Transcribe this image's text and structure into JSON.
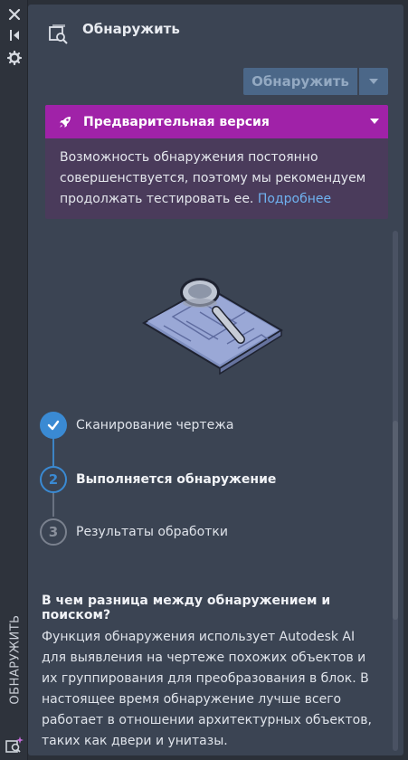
{
  "strip": {
    "icons": [
      "close-icon",
      "collapse-icon",
      "settings-icon",
      "detect-ai-icon"
    ],
    "label": "ОБНАРУЖИТЬ"
  },
  "panel": {
    "title": "Обнаружить",
    "detect_button": "Обнаружить",
    "preview": {
      "title": "Предварительная версия",
      "body": "Возможность обнаружения постоянно совершенствуется, поэтому мы рекомендуем продолжать тестировать ее.",
      "link": "Подробнее"
    },
    "steps": [
      {
        "number": "1",
        "label": "Сканирование чертежа",
        "state": "done"
      },
      {
        "number": "2",
        "label": "Выполняется обнаружение",
        "state": "active"
      },
      {
        "number": "3",
        "label": "Результаты обработки",
        "state": "pending"
      }
    ],
    "faq": {
      "question": "В чем разница между обнаружением и поиском?",
      "answer": "Функция обнаружения использует Autodesk AI для выявления на чертеже похожих объектов и их группирования для преобразования в блок. В настоящее время обнаружение лучше всего работает в отношении архитектурных объектов, таких как двери и унитазы."
    }
  },
  "colors": {
    "panel_bg": "#3b4453",
    "accent_blue": "#3a8ad3",
    "preview_header": "#a022a8",
    "preview_body": "#4a3b5b",
    "link": "#6fb2f0"
  }
}
